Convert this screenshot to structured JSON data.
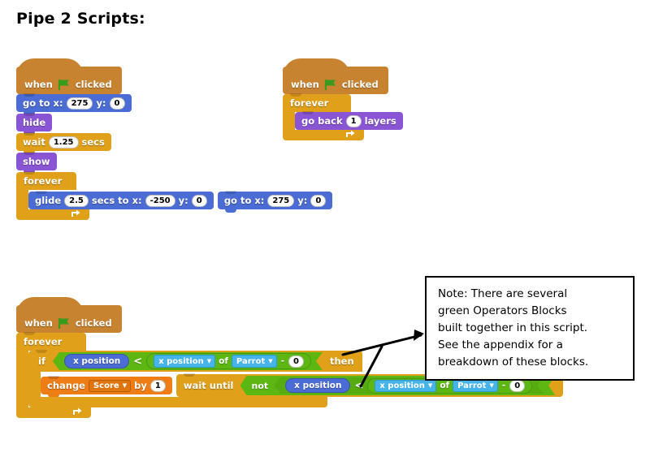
{
  "page": {
    "title": "Pipe 2 Scripts:"
  },
  "colors": {
    "events": "#c88330",
    "motion": "#4a6cd4",
    "looks": "#8a55d5",
    "control": "#e0a019",
    "data": "#ee7d16",
    "sensing": "#2ca5e2",
    "operators": "#5cb712",
    "note_border": "#000000",
    "background": "#ffffff"
  },
  "icons": {
    "green_flag": "green-flag-icon",
    "loop_arrow": "↻",
    "dropdown_arrow": "▼"
  },
  "scripts": [
    {
      "id": "script-1",
      "name": "pipe-movement-script",
      "hat": {
        "when": "when",
        "flag": "green-flag-icon",
        "clicked": "clicked"
      },
      "blocks": {
        "goto1": {
          "go_to_x": "go to x:",
          "x": "275",
          "y_label": "y:",
          "y": "0"
        },
        "hide": {
          "label": "hide"
        },
        "wait": {
          "wait": "wait",
          "secs": "1.25",
          "secs_label": "secs"
        },
        "show": {
          "label": "show"
        },
        "forever": {
          "label": "forever"
        },
        "glide": {
          "glide": "glide",
          "secs": "2.5",
          "secs_to_x": "secs to x:",
          "x": "-250",
          "y_label": "y:",
          "y": "0"
        },
        "goto2": {
          "go_to_x": "go to x:",
          "x": "275",
          "y_label": "y:",
          "y": "0"
        }
      }
    },
    {
      "id": "script-2",
      "name": "layer-script",
      "hat": {
        "when": "when",
        "flag": "green-flag-icon",
        "clicked": "clicked"
      },
      "blocks": {
        "forever": {
          "label": "forever"
        },
        "go_back": {
          "go_back": "go back",
          "layers_num": "1",
          "layers": "layers"
        }
      }
    },
    {
      "id": "script-3",
      "name": "score-script",
      "hat": {
        "when": "when",
        "flag": "green-flag-icon",
        "clicked": "clicked"
      },
      "blocks": {
        "forever": {
          "label": "forever"
        },
        "if": {
          "if_label": "if",
          "then_label": "then",
          "left_operand": "x position",
          "comparator": "<",
          "right": {
            "attribute": "x position",
            "of": "of",
            "target": "Parrot",
            "minus": "-",
            "offset": "0"
          }
        },
        "change_score": {
          "change": "change",
          "variable": "Score",
          "by": "by",
          "amount": "1"
        },
        "wait_until": {
          "wait_until": "wait until",
          "not": "not",
          "left_operand": "x position",
          "comparator": "<",
          "right": {
            "attribute": "x position",
            "of": "of",
            "target": "Parrot",
            "minus": "-",
            "offset": "0"
          }
        }
      }
    }
  ],
  "note": {
    "name": "operators-note",
    "lines": [
      "Note: There are several",
      "green Operators Blocks",
      "built together in this script.",
      "See the appendix for a",
      "breakdown of these blocks."
    ]
  }
}
